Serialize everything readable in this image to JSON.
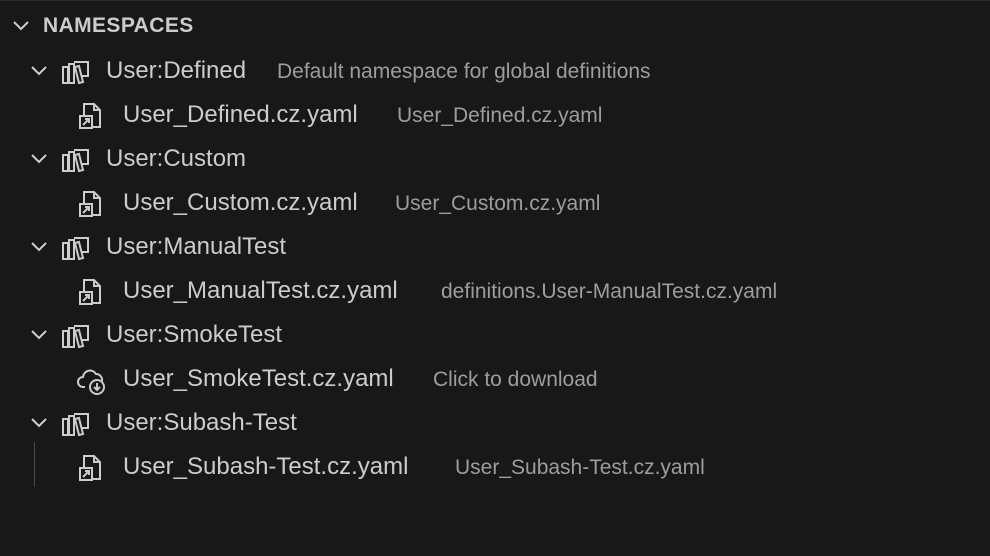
{
  "section": {
    "title": "NAMESPACES"
  },
  "tree": [
    {
      "label": "User:Defined",
      "description": "Default namespace for global definitions",
      "child": {
        "label": "User_Defined.cz.yaml",
        "description": "User_Defined.cz.yaml",
        "icon": "file-link-icon"
      }
    },
    {
      "label": "User:Custom",
      "description": "",
      "child": {
        "label": "User_Custom.cz.yaml",
        "description": "User_Custom.cz.yaml",
        "icon": "file-link-icon"
      }
    },
    {
      "label": "User:ManualTest",
      "description": "",
      "child": {
        "label": "User_ManualTest.cz.yaml",
        "description": "definitions.User-ManualTest.cz.yaml",
        "icon": "file-link-icon"
      }
    },
    {
      "label": "User:SmokeTest",
      "description": "",
      "child": {
        "label": "User_SmokeTest.cz.yaml",
        "description": "Click to download",
        "icon": "cloud-download-icon"
      }
    },
    {
      "label": "User:Subash-Test",
      "description": "",
      "child": {
        "label": "User_Subash-Test.cz.yaml",
        "description": "User_Subash-Test.cz.yaml",
        "icon": "file-link-icon"
      }
    }
  ],
  "colors": {
    "background": "#181818",
    "text": "#cccccc",
    "description": "#9d9d9d"
  }
}
